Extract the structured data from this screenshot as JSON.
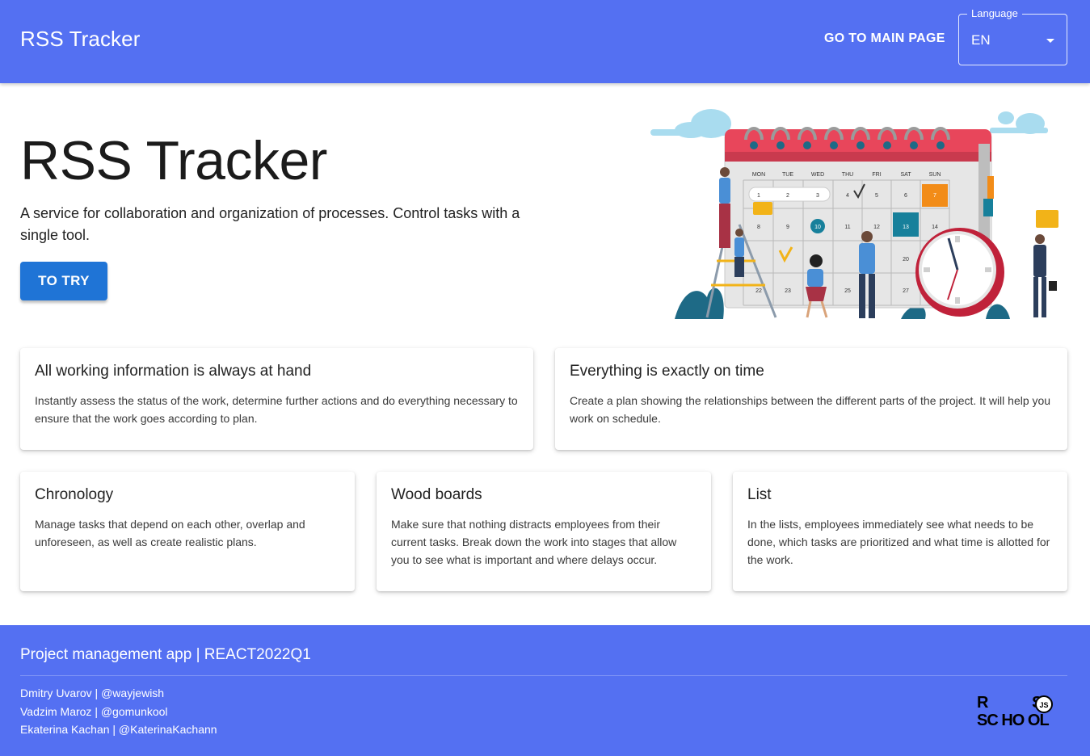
{
  "header": {
    "app_title": "RSS Tracker",
    "nav_main": "GO TO MAIN PAGE",
    "language": {
      "legend": "Language",
      "value": "EN"
    },
    "background": "#5470f2"
  },
  "hero": {
    "title": "RSS Tracker",
    "description": "A service for collaboration and organization of processes. Control tasks with a single tool.",
    "cta_label": "TO TRY",
    "illustration": {
      "weekdays": [
        "MON",
        "TUE",
        "WED",
        "THU",
        "FRI",
        "SAT",
        "SUN"
      ],
      "days_row1": [
        "1",
        "2",
        "3",
        "4",
        "5",
        "6",
        "7"
      ],
      "days_row2": [
        "8",
        "9",
        "10",
        "11",
        "12",
        "13",
        "14"
      ],
      "days_row3": [
        "20"
      ],
      "days_row4": [
        "22",
        "23",
        "25",
        "27"
      ]
    }
  },
  "features": [
    {
      "title": "All working information is always at hand",
      "text": "Instantly assess the status of the work, determine further actions and do everything necessary to ensure that the work goes according to plan."
    },
    {
      "title": "Everything is exactly on time",
      "text": "Create a plan showing the relationships between the different parts of the project. It will help you work on schedule."
    },
    {
      "title": "Chronology",
      "text": "Manage tasks that depend on each other, overlap and unforeseen, as well as create realistic plans."
    },
    {
      "title": "Wood boards",
      "text": "Make sure that nothing distracts employees from their current tasks. Break down the work into stages that allow you to see what is important and where delays occur."
    },
    {
      "title": "List",
      "text": "In the lists, employees immediately see what needs to be done, which tasks are prioritized and what time is allotted for the work."
    }
  ],
  "footer": {
    "heading": "Project management app | REACT2022Q1",
    "authors": [
      "Dmitry Uvarov | @wayjewish",
      "Vadzim Maroz | @gomunkool",
      "Ekaterina Kachan | @KaterinaKachann"
    ],
    "logo": {
      "line1": "RS",
      "line2": "SCHOOL",
      "badge": "JS"
    }
  },
  "colors": {
    "primary": "#5470f2",
    "button": "#1f74d6",
    "calendar_header": "#e8465b",
    "accent_orange": "#f28c18",
    "accent_teal": "#17809b"
  }
}
